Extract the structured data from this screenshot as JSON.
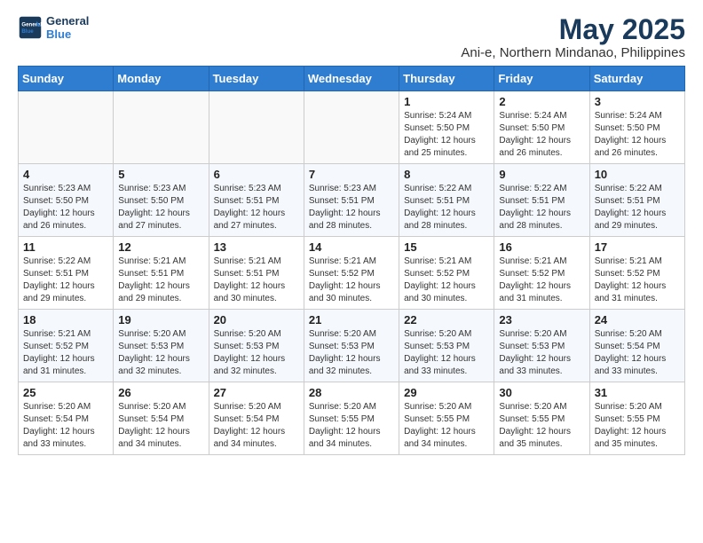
{
  "logo": {
    "line1": "General",
    "line2": "Blue"
  },
  "title": "May 2025",
  "subtitle": "Ani-e, Northern Mindanao, Philippines",
  "days_of_week": [
    "Sunday",
    "Monday",
    "Tuesday",
    "Wednesday",
    "Thursday",
    "Friday",
    "Saturday"
  ],
  "weeks": [
    [
      {
        "num": "",
        "info": ""
      },
      {
        "num": "",
        "info": ""
      },
      {
        "num": "",
        "info": ""
      },
      {
        "num": "",
        "info": ""
      },
      {
        "num": "1",
        "info": "Sunrise: 5:24 AM\nSunset: 5:50 PM\nDaylight: 12 hours and 25 minutes."
      },
      {
        "num": "2",
        "info": "Sunrise: 5:24 AM\nSunset: 5:50 PM\nDaylight: 12 hours and 26 minutes."
      },
      {
        "num": "3",
        "info": "Sunrise: 5:24 AM\nSunset: 5:50 PM\nDaylight: 12 hours and 26 minutes."
      }
    ],
    [
      {
        "num": "4",
        "info": "Sunrise: 5:23 AM\nSunset: 5:50 PM\nDaylight: 12 hours and 26 minutes."
      },
      {
        "num": "5",
        "info": "Sunrise: 5:23 AM\nSunset: 5:50 PM\nDaylight: 12 hours and 27 minutes."
      },
      {
        "num": "6",
        "info": "Sunrise: 5:23 AM\nSunset: 5:51 PM\nDaylight: 12 hours and 27 minutes."
      },
      {
        "num": "7",
        "info": "Sunrise: 5:23 AM\nSunset: 5:51 PM\nDaylight: 12 hours and 28 minutes."
      },
      {
        "num": "8",
        "info": "Sunrise: 5:22 AM\nSunset: 5:51 PM\nDaylight: 12 hours and 28 minutes."
      },
      {
        "num": "9",
        "info": "Sunrise: 5:22 AM\nSunset: 5:51 PM\nDaylight: 12 hours and 28 minutes."
      },
      {
        "num": "10",
        "info": "Sunrise: 5:22 AM\nSunset: 5:51 PM\nDaylight: 12 hours and 29 minutes."
      }
    ],
    [
      {
        "num": "11",
        "info": "Sunrise: 5:22 AM\nSunset: 5:51 PM\nDaylight: 12 hours and 29 minutes."
      },
      {
        "num": "12",
        "info": "Sunrise: 5:21 AM\nSunset: 5:51 PM\nDaylight: 12 hours and 29 minutes."
      },
      {
        "num": "13",
        "info": "Sunrise: 5:21 AM\nSunset: 5:51 PM\nDaylight: 12 hours and 30 minutes."
      },
      {
        "num": "14",
        "info": "Sunrise: 5:21 AM\nSunset: 5:52 PM\nDaylight: 12 hours and 30 minutes."
      },
      {
        "num": "15",
        "info": "Sunrise: 5:21 AM\nSunset: 5:52 PM\nDaylight: 12 hours and 30 minutes."
      },
      {
        "num": "16",
        "info": "Sunrise: 5:21 AM\nSunset: 5:52 PM\nDaylight: 12 hours and 31 minutes."
      },
      {
        "num": "17",
        "info": "Sunrise: 5:21 AM\nSunset: 5:52 PM\nDaylight: 12 hours and 31 minutes."
      }
    ],
    [
      {
        "num": "18",
        "info": "Sunrise: 5:21 AM\nSunset: 5:52 PM\nDaylight: 12 hours and 31 minutes."
      },
      {
        "num": "19",
        "info": "Sunrise: 5:20 AM\nSunset: 5:53 PM\nDaylight: 12 hours and 32 minutes."
      },
      {
        "num": "20",
        "info": "Sunrise: 5:20 AM\nSunset: 5:53 PM\nDaylight: 12 hours and 32 minutes."
      },
      {
        "num": "21",
        "info": "Sunrise: 5:20 AM\nSunset: 5:53 PM\nDaylight: 12 hours and 32 minutes."
      },
      {
        "num": "22",
        "info": "Sunrise: 5:20 AM\nSunset: 5:53 PM\nDaylight: 12 hours and 33 minutes."
      },
      {
        "num": "23",
        "info": "Sunrise: 5:20 AM\nSunset: 5:53 PM\nDaylight: 12 hours and 33 minutes."
      },
      {
        "num": "24",
        "info": "Sunrise: 5:20 AM\nSunset: 5:54 PM\nDaylight: 12 hours and 33 minutes."
      }
    ],
    [
      {
        "num": "25",
        "info": "Sunrise: 5:20 AM\nSunset: 5:54 PM\nDaylight: 12 hours and 33 minutes."
      },
      {
        "num": "26",
        "info": "Sunrise: 5:20 AM\nSunset: 5:54 PM\nDaylight: 12 hours and 34 minutes."
      },
      {
        "num": "27",
        "info": "Sunrise: 5:20 AM\nSunset: 5:54 PM\nDaylight: 12 hours and 34 minutes."
      },
      {
        "num": "28",
        "info": "Sunrise: 5:20 AM\nSunset: 5:55 PM\nDaylight: 12 hours and 34 minutes."
      },
      {
        "num": "29",
        "info": "Sunrise: 5:20 AM\nSunset: 5:55 PM\nDaylight: 12 hours and 34 minutes."
      },
      {
        "num": "30",
        "info": "Sunrise: 5:20 AM\nSunset: 5:55 PM\nDaylight: 12 hours and 35 minutes."
      },
      {
        "num": "31",
        "info": "Sunrise: 5:20 AM\nSunset: 5:55 PM\nDaylight: 12 hours and 35 minutes."
      }
    ]
  ]
}
